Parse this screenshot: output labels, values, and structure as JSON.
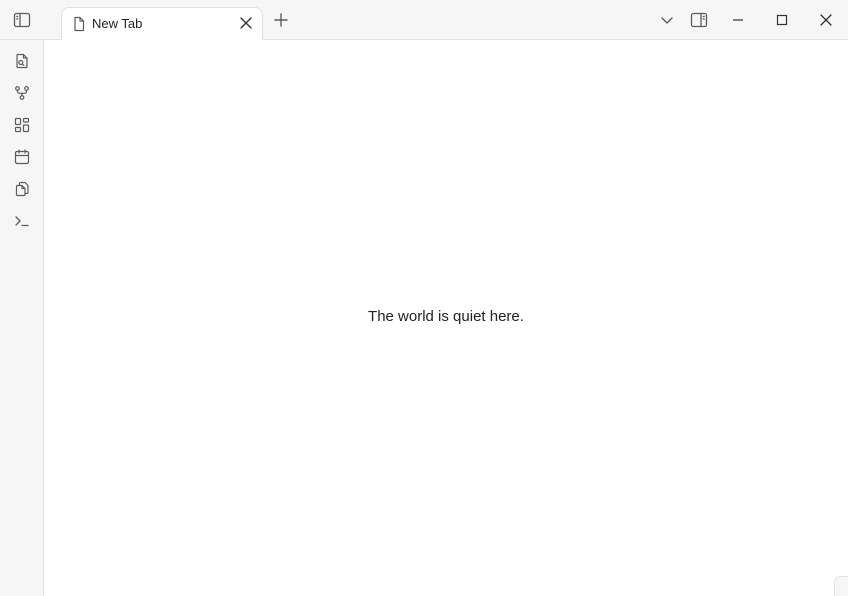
{
  "tabs": [
    {
      "label": "New Tab",
      "icon": "file-icon",
      "active": true
    }
  ],
  "main": {
    "empty_message": "The world is quiet here."
  },
  "ribbon": {
    "items": [
      {
        "icon": "file-search-icon"
      },
      {
        "icon": "graph-view-icon"
      },
      {
        "icon": "canvas-grid-icon"
      },
      {
        "icon": "calendar-icon"
      },
      {
        "icon": "copy-files-icon"
      },
      {
        "icon": "terminal-icon"
      }
    ]
  },
  "colors": {
    "chrome_background": "#f6f6f6",
    "border": "#e2e2e2",
    "icon": "#5c5c5c",
    "text": "#222222"
  }
}
